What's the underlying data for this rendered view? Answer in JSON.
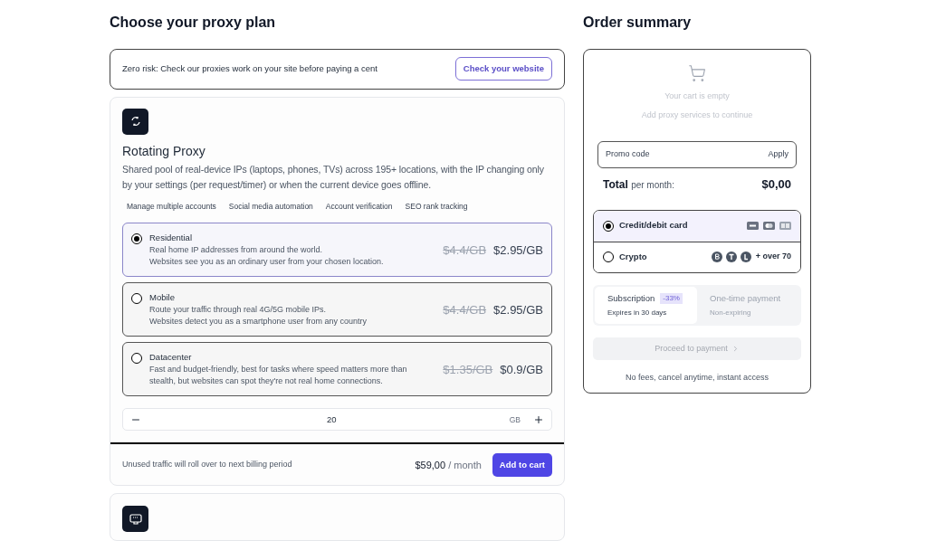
{
  "plan": {
    "heading": "Choose your proxy plan",
    "banner": {
      "text": "Zero risk: Check our proxies work on your site before paying a cent",
      "button": "Check your website"
    },
    "product": {
      "title": "Rotating Proxy",
      "description": "Shared pool of real-device IPs (laptops, phones, TVs) across 195+ locations, with the IP changing only by your settings (per request/timer) or when the current device goes offline.",
      "tags": [
        "Manage multiple accounts",
        "Social media automation",
        "Account verification",
        "SEO rank tracking"
      ],
      "options": [
        {
          "name": "Residential",
          "lines": [
            "Real home IP addresses from around the world.",
            "Websites see you as an ordinary user from your chosen location."
          ],
          "old_price": "$4.4/GB",
          "price": "$2.95/GB",
          "selected": true
        },
        {
          "name": "Mobile",
          "lines": [
            "Route your traffic through real 4G/5G mobile IPs.",
            "Websites detect you as a smartphone user from any country"
          ],
          "old_price": "$4.4/GB",
          "price": "$2.95/GB",
          "selected": false
        },
        {
          "name": "Datacenter",
          "lines": [
            "Fast and budget-friendly, best for tasks where speed matters more than",
            "stealth, but websites can spot they're not real home connections."
          ],
          "old_price": "$1.35/GB",
          "price": "$0.9/GB",
          "selected": false
        }
      ],
      "quantity": {
        "value": "20",
        "unit": "GB"
      },
      "footer": {
        "note": "Unused traffic will roll over to next billing period",
        "price": "$59,00",
        "period": "/ month",
        "button": "Add to cart"
      }
    }
  },
  "summary": {
    "heading": "Order summary",
    "empty_title": "Your cart is empty",
    "empty_hint": "Add proxy services to continue",
    "promo": {
      "placeholder": "Promo code",
      "button": "Apply"
    },
    "total": {
      "label": "Total",
      "suffix": "per month:",
      "value": "$0,00"
    },
    "payment_methods": [
      {
        "label": "Credit/debit card",
        "kind": "card",
        "selected": true
      },
      {
        "label": "Crypto",
        "kind": "crypto",
        "extra": "+ over 70",
        "selected": false
      }
    ],
    "billing": [
      {
        "title": "Subscription",
        "badge": "-33%",
        "subtitle": "Expires in 30 days",
        "selected": true
      },
      {
        "title": "One-time payment",
        "subtitle": "Non-expiring",
        "selected": false
      }
    ],
    "proceed": {
      "label": "Proceed to payment",
      "disabled": true
    },
    "note": "No fees, cancel anytime, instant access"
  }
}
